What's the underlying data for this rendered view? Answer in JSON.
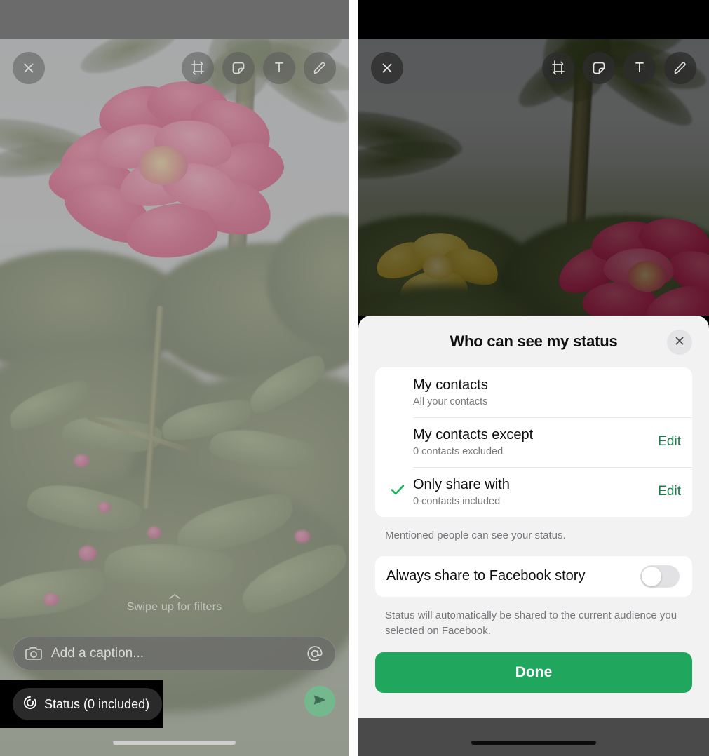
{
  "left_panel": {
    "toolbar": {
      "close_icon": "close-icon",
      "crop_icon": "crop-rotate-icon",
      "sticker_icon": "sticker-icon",
      "text_label": "T",
      "draw_icon": "pencil-icon"
    },
    "swipe_hint": "Swipe up for filters",
    "caption": {
      "placeholder": "Add a caption...",
      "camera_icon": "camera-icon",
      "mention_icon": "at-mention-icon"
    },
    "status_chip": {
      "label": "Status (0 included)",
      "icon": "status-ring-icon"
    },
    "send_icon": "send-paper-plane-icon"
  },
  "right_panel": {
    "toolbar": {
      "close_icon": "close-icon",
      "crop_icon": "crop-rotate-icon",
      "sticker_icon": "sticker-icon",
      "text_label": "T",
      "draw_icon": "pencil-icon"
    },
    "sheet": {
      "title": "Who can see my status",
      "close_icon": "close-icon",
      "options": [
        {
          "title": "My contacts",
          "subtitle": "All your contacts",
          "edit_label": "",
          "selected": false
        },
        {
          "title": "My contacts except",
          "subtitle": "0 contacts excluded",
          "edit_label": "Edit",
          "selected": false
        },
        {
          "title": "Only share with",
          "subtitle": "0 contacts included",
          "edit_label": "Edit",
          "selected": true
        }
      ],
      "mention_note": "Mentioned people can see your status.",
      "facebook_toggle": {
        "label": "Always share to Facebook story",
        "state": "off"
      },
      "facebook_note": "Status will automatically be shared to the current audience you selected on Facebook.",
      "done_label": "Done"
    }
  },
  "colors": {
    "accent_green": "#21a75d",
    "link_green": "#1d7a4d",
    "check_green": "#16b45a",
    "send_green": "#74b98e",
    "sheet_bg": "#f2f2f3",
    "card_bg": "#ffffff"
  }
}
